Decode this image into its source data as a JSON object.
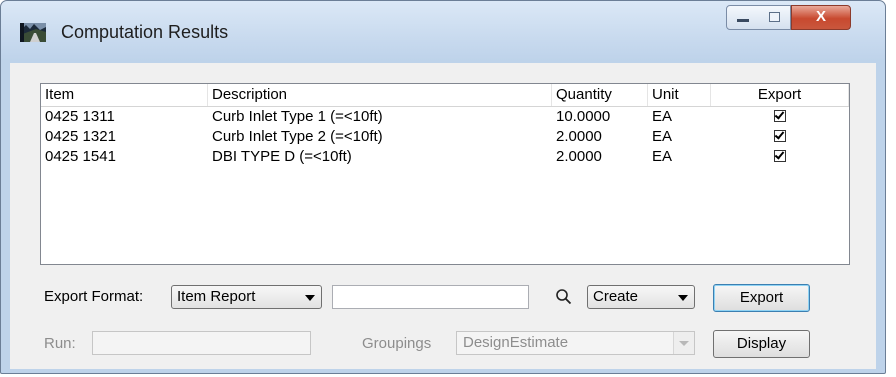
{
  "window": {
    "title": "Computation Results",
    "close_glyph": "X"
  },
  "table": {
    "columns": [
      "Item",
      "Description",
      "Quantity",
      "Unit",
      "Export"
    ],
    "rows": [
      {
        "item": "0425  1311",
        "description": "Curb Inlet Type 1 (=<10ft)",
        "quantity": "10.0000",
        "unit": "EA",
        "export": true
      },
      {
        "item": "0425  1321",
        "description": "Curb Inlet Type 2 (=<10ft)",
        "quantity": "2.0000",
        "unit": "EA",
        "export": true
      },
      {
        "item": "0425  1541",
        "description": "DBI TYPE D (=<10ft)",
        "quantity": "2.0000",
        "unit": "EA",
        "export": true
      }
    ]
  },
  "export_format": {
    "label": "Export Format:",
    "selected": "Item Report",
    "text_value": ""
  },
  "create_combo": {
    "selected": "Create"
  },
  "buttons": {
    "export": "Export",
    "display": "Display"
  },
  "run": {
    "label": "Run:",
    "value": ""
  },
  "groupings": {
    "label": "Groupings",
    "selected": "DesignEstimate"
  },
  "icons": {
    "app": "road-app-icon",
    "search": "magnifier-icon"
  }
}
